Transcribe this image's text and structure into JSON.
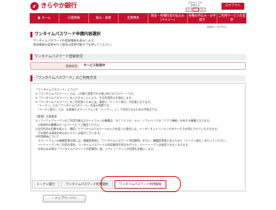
{
  "header": {
    "bank_name": "きらやか銀行",
    "text_size_label1": "文字サイズを",
    "text_size_label2": "変更する",
    "size_small": "小",
    "size_medium": "中",
    "size_large": "大",
    "logout_label": "ログアウト"
  },
  "nav": [
    {
      "label": "ホーム",
      "icon": "house-icon"
    },
    {
      "label": "口座情報",
      "icon": ""
    },
    {
      "label": "振込・振替",
      "icon": ""
    },
    {
      "label": "定期預金",
      "icon": ""
    },
    {
      "label": "税金・各種料金の払込み(ペイジー)",
      "icon": ""
    },
    {
      "label": "各種お申込み・お手続き",
      "icon": ""
    },
    {
      "label": "ご利用サービスの変更",
      "icon": ""
    }
  ],
  "screen_id": "画面ID：BOP001",
  "page": {
    "title": "ワンタイムパスワード申請内容選択",
    "intro_line1": "ワンタイムパスワードの登録情報を表示します。",
    "intro_line2": "登録情報の変更を行う場合は変更対象タブを押してください。"
  },
  "registration": {
    "heading": "ワンタイムパスワード登録状況",
    "status_label": "登録状況",
    "status_value": "サービス利用中"
  },
  "usage": {
    "heading": "「ワンタイムパスワード」のご利用方法",
    "lines": [
      "「ワンタイムパスワード」について",
      "①「ワンタイムパスワード」とは、1分間で変更される使い捨てのパスワードです。",
      "②「ワンタイムパスワード」を入力することにより、不正利用防止を強化します。",
      "③「ワンタイムパスワード」をご利用頂くためには、事前に「トークン発行」が必要となります。",
      "　「トークン」とは「ワンタイムパスワード」の表示装置です。",
      "　「トークン発行」とは、お客様のスマートフォンを「トークン」として利用できるための手続きです。",
      "",
      "【重要】注意事項",
      "①ソフトウェアトークンのご利用可能なスマートフォンの機種は、ＮＴＴドコモ・ａｕ・ソフトバンクの「アプリ機能」を有する機種となります。",
      "　※具体的な機種はホームページにてご確認ください。",
      "②当行所定の回数を超えて、連続してワンタイムパスワードの入力を誤った場合には、インターネットバンキングのサービスを停止させていただきます。",
      "　その場合は再度お申込みいただく必要がございます。",
      "③利用開始について",
      "　スマートフォンの機種変更の際には、機種変更前に「ワンタイムパスワード利用解除」を行い、機種変更後にあらためて「トークン発行」を行ってください。",
      "　ハードトークンをご利用の場合、ワンタイムパスワードの利用解除手続きを行うと、ハードトークンは使用できなくなります。",
      "　お申込みの際は「ワンタイムパスワード利用解除」後、ソフトトークンへの切替をお願いします。"
    ]
  },
  "tabs": [
    {
      "label": "トークン発行",
      "active": false
    },
    {
      "label": "ワンタイムパスワード利用開始",
      "active": false
    },
    {
      "label": "ワンタイムパスワード利用解除",
      "active": true
    }
  ],
  "back_label": "トップページへ",
  "colors": {
    "brand": "#c8102e",
    "highlight_circle": "#e00000"
  }
}
